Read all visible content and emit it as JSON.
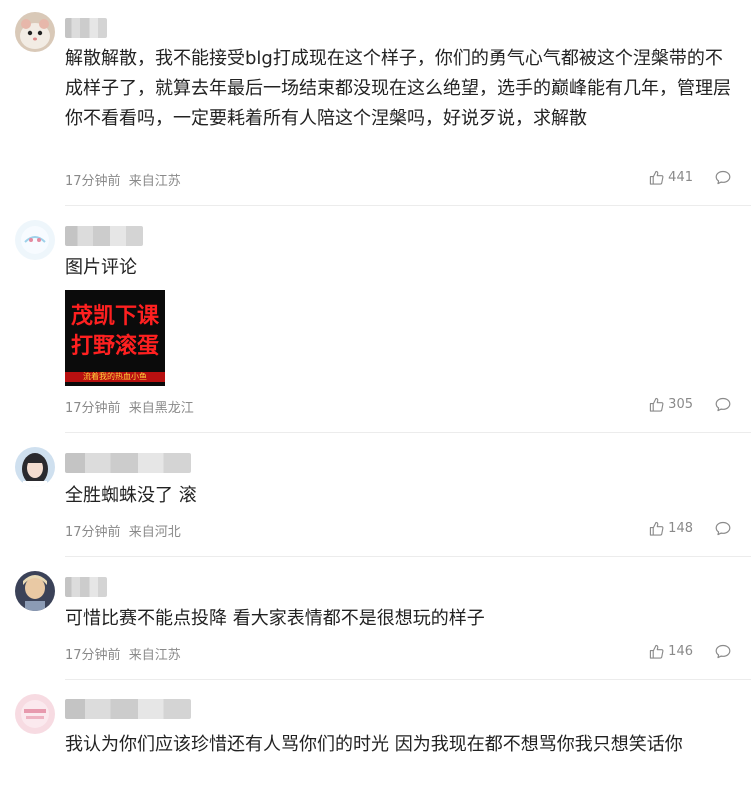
{
  "comments": [
    {
      "text": "解散解散，我不能接受blg打成现在这个样子，你们的勇气心气都被这个涅槃带的不成样子了，就算去年最后一场结束都没现在这么绝望，选手的巅峰能有几年，管理层你不看看吗，一定要耗着所有人陪这个涅槃吗，好说歹说，求解散",
      "time": "17分钟前",
      "location": "来自江苏",
      "likes": "441",
      "avatar_icon": "hamster-avatar"
    },
    {
      "text": "图片评论",
      "image": {
        "line1": "茂凯下课",
        "line2": "打野滚蛋",
        "caption": "流着我的热血小鱼"
      },
      "time": "17分钟前",
      "location": "来自黑龙江",
      "likes": "305",
      "avatar_icon": "light-avatar"
    },
    {
      "text": "全胜蜘蛛没了 滚",
      "time": "17分钟前",
      "location": "来自河北",
      "likes": "148",
      "avatar_icon": "girl-avatar"
    },
    {
      "text": "可惜比赛不能点投降 看大家表情都不是很想玩的样子",
      "time": "17分钟前",
      "location": "来自江苏",
      "likes": "146",
      "avatar_icon": "person-avatar"
    },
    {
      "text": "我认为你们应该珍惜还有人骂你们的时光 因为我现在都不想骂你我只想笑话你",
      "avatar_icon": "pink-avatar"
    }
  ],
  "colors": {
    "meta": "#8a8a8a",
    "text": "#222222",
    "divider": "#ececec",
    "image_text": "#ff2020"
  }
}
